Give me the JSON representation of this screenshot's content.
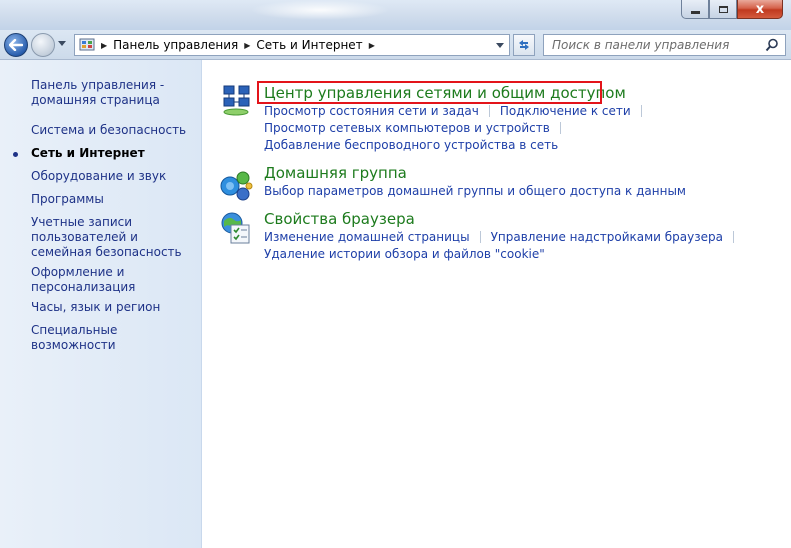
{
  "address_bar": {
    "crumbs": [
      "Панель управления",
      "Сеть и Интернет"
    ]
  },
  "search": {
    "placeholder": "Поиск в панели управления"
  },
  "window_buttons": {
    "close": "x"
  },
  "left_pane": {
    "home": "Панель управления - домашняя страница",
    "items": [
      "Система и безопасность",
      "Сеть и Интернет",
      "Оборудование и звук",
      "Программы",
      "Учетные записи пользователей и семейная безопасность",
      "Оформление и персонализация",
      "Часы, язык и регион",
      "Специальные возможности"
    ],
    "current_index": 1
  },
  "categories": [
    {
      "title": "Центр управления сетями и общим доступом",
      "icon": "network-center-icon",
      "links": [
        "Просмотр состояния сети и задач",
        "Подключение к сети",
        "Просмотр сетевых компьютеров и устройств",
        "Добавление беспроводного устройства в сеть"
      ]
    },
    {
      "title": "Домашняя группа",
      "icon": "homegroup-icon",
      "links": [
        "Выбор параметров домашней группы и общего доступа к данным"
      ]
    },
    {
      "title": "Свойства браузера",
      "icon": "internet-options-icon",
      "links": [
        "Изменение домашней страницы",
        "Управление надстройками браузера",
        "Удаление истории обзора и файлов \"cookie\""
      ]
    }
  ],
  "colors": {
    "link": "#1e3fa8",
    "category_title": "#1d7b1d",
    "left_link": "#1e3287",
    "highlight_box": "#e3141a"
  }
}
